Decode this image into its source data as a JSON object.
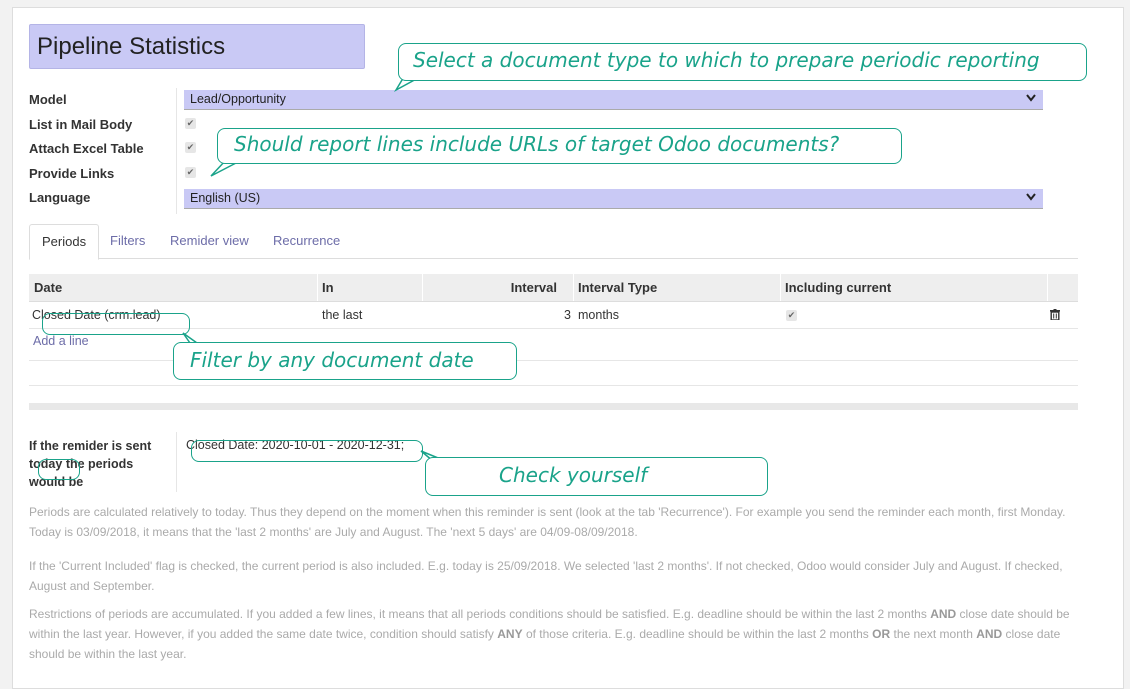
{
  "form": {
    "title": "Pipeline Statistics",
    "fields": [
      {
        "label": "Model",
        "value": "Lead/Opportunity"
      },
      {
        "label": "List in Mail Body",
        "value": "✔"
      },
      {
        "label": "Attach Excel Table",
        "value": "✔"
      },
      {
        "label": "Provide Links",
        "value": "✔"
      },
      {
        "label": "Language",
        "value": "English (US)"
      }
    ]
  },
  "tabs": [
    "Periods",
    "Filters",
    "Remider view",
    "Recurrence"
  ],
  "table": {
    "headers": [
      "Date",
      "In",
      "Interval",
      "Interval Type",
      "Including current"
    ],
    "rows": [
      {
        "date": "Closed Date (crm.lead)",
        "in": "the last",
        "interval": "3",
        "type": "months",
        "current": "✔"
      }
    ],
    "add_line": "Add a line"
  },
  "reminder": {
    "label_prefix": "If the remider is sent ",
    "label_today": "today",
    "label_suffix": " the periods would be",
    "value": "Closed Date: 2020-10-01 - 2020-12-31;"
  },
  "notes": [
    "Periods are calculated relatively to today. Thus they depend on the moment when this reminder is sent (look at the tab 'Recurrence'). For example you send the reminder each month, first Monday. Today is 03/09/2018, it means that the 'last 2 months' are July and August. The 'next 5 days' are 04/09-08/09/2018.",
    "If the 'Current Included' flag is checked, the current period is also included. E.g. today is 25/09/2018. We selected 'last 2 months'. If not checked, Odoo would consider July and August. If checked, August and September.",
    {
      "p1": "Restrictions of periods are accumulated. If you added a few lines, it means that all periods conditions should be satisfied. E.g. deadline should be within the last 2 months ",
      "b1": "AND",
      "p2": " close date should be within the last year. However, if you added the same date twice, condition should satisfy ",
      "b2": "ANY",
      "p3": " of those criteria. E.g. deadline should be within the last 2 months ",
      "b3": "OR",
      "p4": " the next month ",
      "b4": "AND",
      "p5": " close date should be within the last year."
    }
  ],
  "callouts": {
    "doc_type": "Select a document type to which to prepare periodic reporting",
    "urls": "Should report lines include URLs of target Odoo documents?",
    "filter": "Filter by any document date",
    "check": "Check yourself"
  },
  "colors": {
    "accent": "#1aa38a",
    "field_bg": "#c9c9f5",
    "link": "#6d6da8"
  }
}
